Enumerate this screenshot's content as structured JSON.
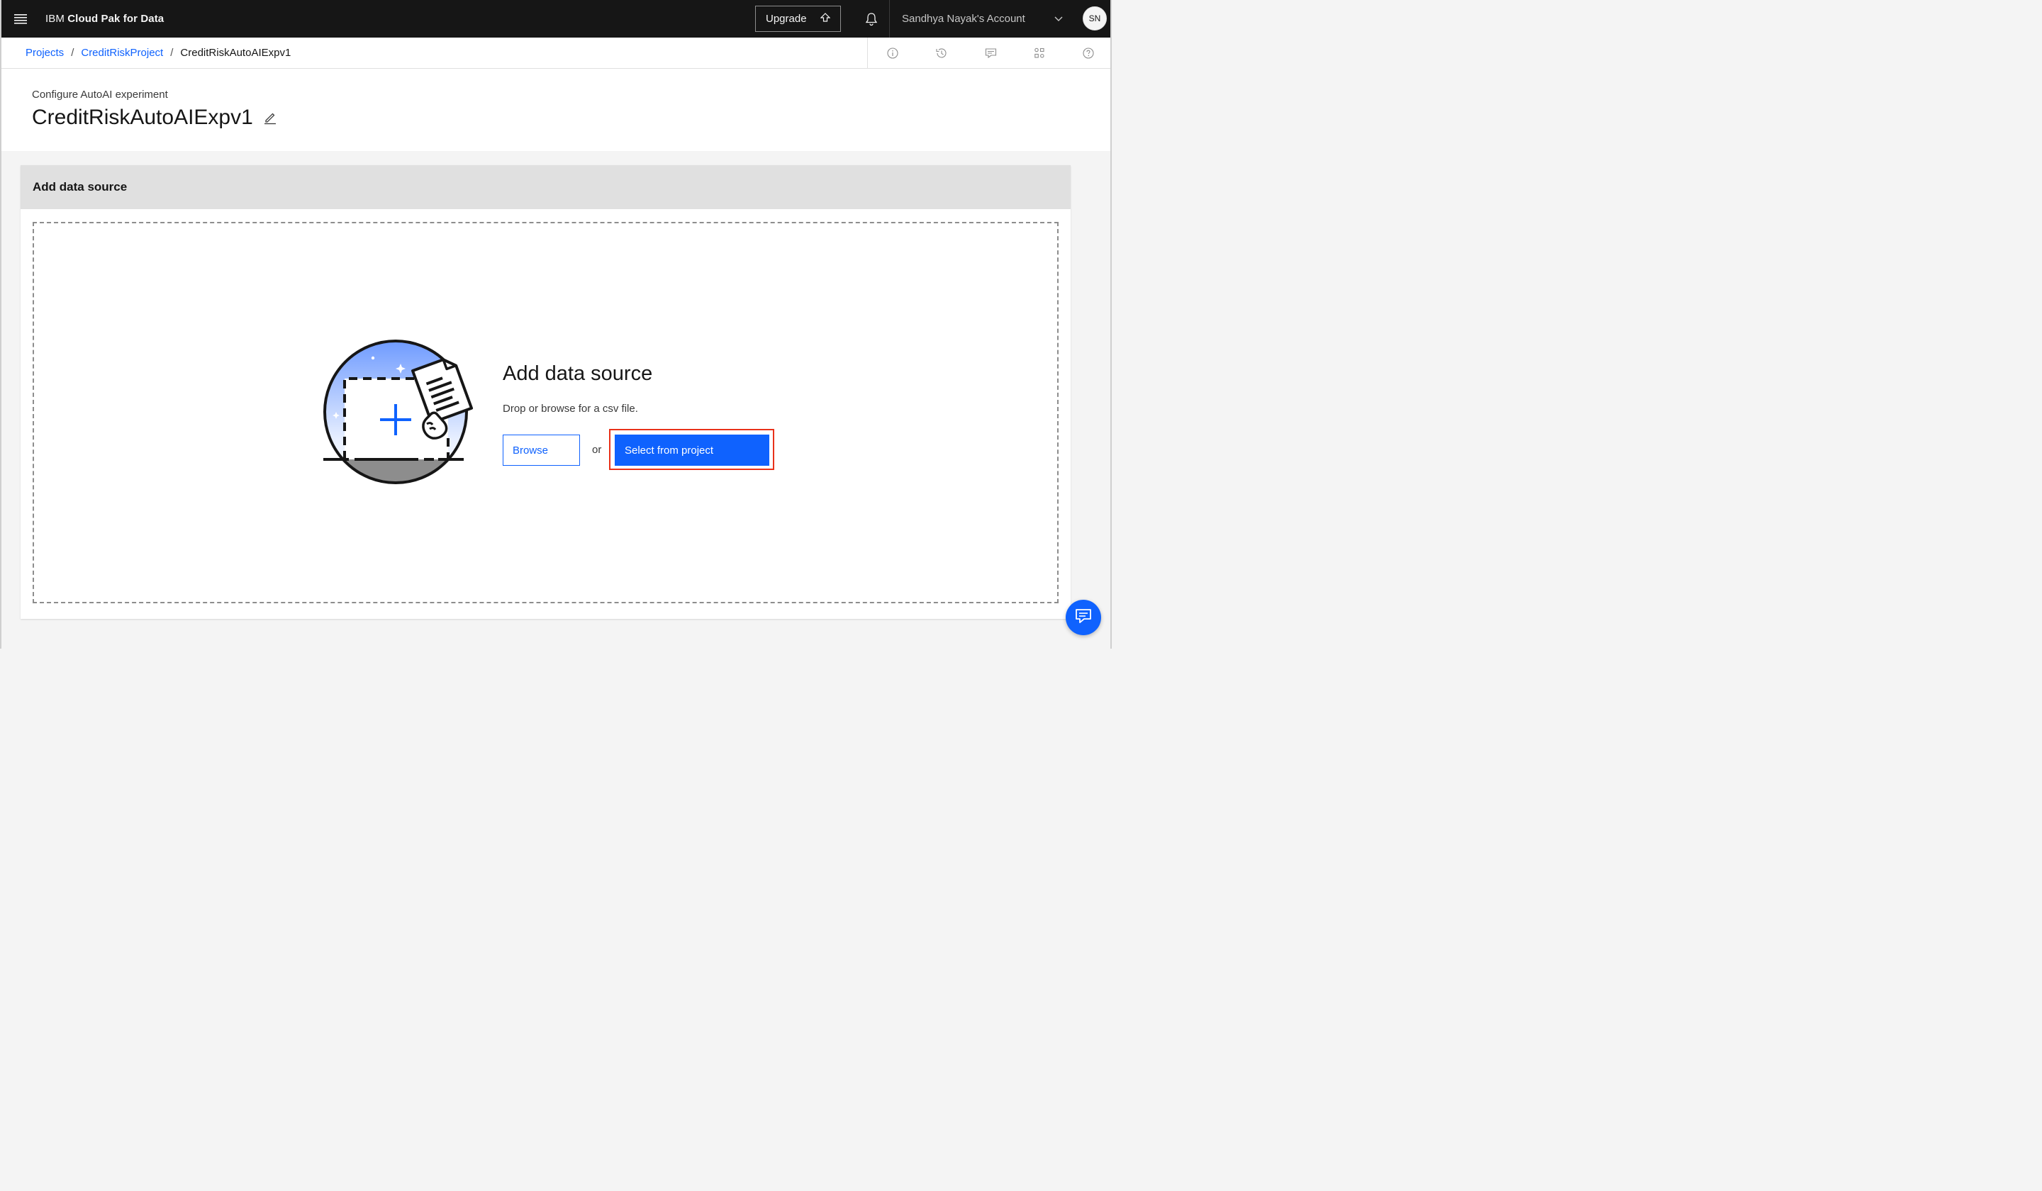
{
  "topbar": {
    "brand_prefix": "IBM ",
    "brand_name": "Cloud Pak for Data",
    "upgrade_label": "Upgrade",
    "account_name": "Sandhya Nayak's Account",
    "avatar_initials": "SN"
  },
  "breadcrumb": {
    "items": [
      "Projects",
      "CreditRiskProject"
    ],
    "separator": "/",
    "current": "CreditRiskAutoAIExpv1"
  },
  "toolbar_icons": [
    "info-icon",
    "history-icon",
    "comment-icon",
    "asset-tree-icon",
    "help-icon"
  ],
  "header": {
    "subtitle": "Configure AutoAI experiment",
    "title": "CreditRiskAutoAIExpv1"
  },
  "panel": {
    "heading": "Add data source",
    "dropzone_title": "Add data source",
    "dropzone_subtitle": "Drop or browse for a csv file.",
    "browse_label": "Browse",
    "or_label": "or",
    "select_label": "Select from project"
  },
  "colors": {
    "accent": "#0f62fe",
    "topbar": "#161616",
    "highlight": "#e8311a"
  }
}
